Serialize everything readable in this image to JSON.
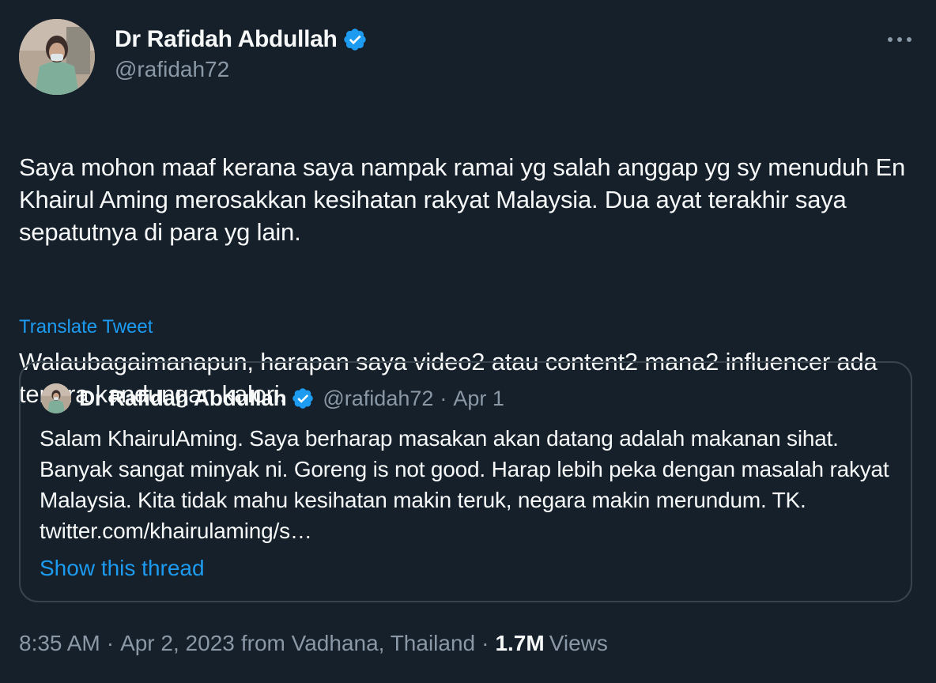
{
  "author": {
    "display_name": "Dr Rafidah Abdullah",
    "handle": "@rafidah72",
    "avatar": "profile-photo",
    "verified_icon": "verified-badge-icon"
  },
  "tweet": {
    "paragraph1": "Saya mohon maaf kerana saya nampak ramai yg salah anggap yg sy menuduh En Khairul Aming merosakkan kesihatan rakyat Malaysia. Dua ayat terakhir saya sepatutnya di para yg lain.",
    "paragraph2": "Walaubagaimanapun, harapan saya video2 atau content2 mana2 influencer ada tertera kandungan kalori.",
    "translate_label": "Translate Tweet",
    "more_icon": "more-options-icon"
  },
  "quoted_tweet": {
    "display_name": "Dr Rafidah Abdullah",
    "handle": "@rafidah72",
    "separator": "·",
    "date": "Apr 1",
    "text": "Salam KhairulAming. Saya berharap masakan akan datang adalah makanan sihat. Banyak sangat minyak ni. Goreng is not good. Harap lebih peka dengan masalah rakyat Malaysia. Kita tidak mahu kesihatan makin teruk, negara makin merundum. TK. twitter.com/khairulaming/s…",
    "show_thread_label": "Show this thread"
  },
  "meta": {
    "time": "8:35 AM",
    "sep1": "·",
    "date": "Apr 2, 2023",
    "location": "from Vadhana, Thailand",
    "sep2": "·",
    "views_count": "1.7M",
    "views_label": "Views"
  },
  "colors": {
    "background": "#15202b",
    "text_primary": "#f7f9f9",
    "text_secondary": "#8b98a5",
    "accent_blue": "#1d9bf0",
    "border": "#38444d"
  }
}
